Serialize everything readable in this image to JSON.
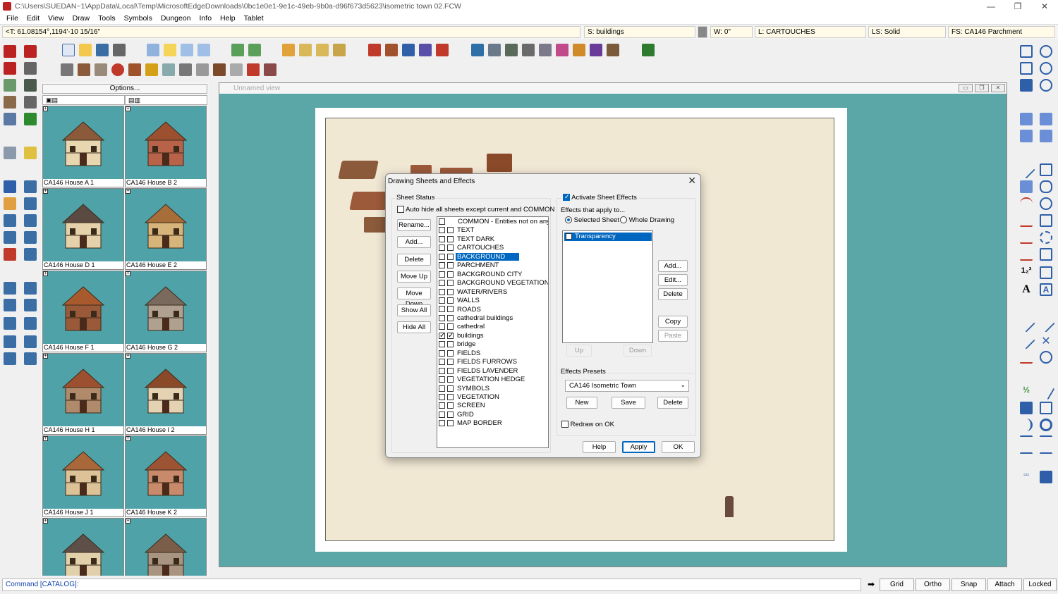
{
  "titlebar": {
    "title": "C:\\Users\\SUEDAN~1\\AppData\\Local\\Temp\\MicrosoftEdgeDownloads\\0bc1e0e1-9e1c-49eb-9b0a-d96f673d5623\\isometric town 02.FCW",
    "minimize": "—",
    "maximize": "❐",
    "close": "✕"
  },
  "menu": [
    "File",
    "Edit",
    "View",
    "Draw",
    "Tools",
    "Symbols",
    "Dungeon",
    "Info",
    "Help",
    "Tablet"
  ],
  "status": {
    "coords": "<T: 61.08154°,1194'-10 15/16\"",
    "sheet": "S: buildings",
    "width": "W: 0\"",
    "layer": "L: CARTOUCHES",
    "linestyle": "LS: Solid",
    "fillstyle": "FS: CA146 Parchment"
  },
  "catalog": {
    "options": "Options...",
    "items": [
      {
        "name": "CA146 House A 1",
        "roof": "#8a5a3a",
        "wall": "#e8d6b0"
      },
      {
        "name": "CA146 House B 2",
        "roof": "#9c5030",
        "wall": "#b8624a"
      },
      {
        "name": "CA146 House D 1",
        "roof": "#5a4a42",
        "wall": "#e6d2aa"
      },
      {
        "name": "CA146 House E 2",
        "roof": "#a86e3a",
        "wall": "#d6b47a"
      },
      {
        "name": "CA146 House F 1",
        "roof": "#a85a2e",
        "wall": "#9a5a3a"
      },
      {
        "name": "CA146 House G 2",
        "roof": "#7a6a5e",
        "wall": "#b0a090"
      },
      {
        "name": "CA146 House H 1",
        "roof": "#9c5030",
        "wall": "#b08a6a"
      },
      {
        "name": "CA146 House I 2",
        "roof": "#8a4a2a",
        "wall": "#e4d2b2"
      },
      {
        "name": "CA146 House J 1",
        "roof": "#a8683a",
        "wall": "#dcc296"
      },
      {
        "name": "CA146 House K 2",
        "roof": "#9c5434",
        "wall": "#c88a6a"
      },
      {
        "name": "",
        "roof": "#5e5048",
        "wall": "#e2d0aa"
      },
      {
        "name": "",
        "roof": "#7a5e4a",
        "wall": "#a89480"
      }
    ]
  },
  "viewport": {
    "title": "Unnamed view"
  },
  "command": {
    "text": "Command [CATALOG]:"
  },
  "statusbuttons": [
    "Grid",
    "Ortho",
    "Snap",
    "Attach",
    "Locked"
  ],
  "dialog": {
    "title": "Drawing Sheets and Effects",
    "close": "✕",
    "sheet_status": "Sheet Status",
    "auto_hide": "Auto hide all sheets except current and COMMON",
    "buttons": [
      "Rename...",
      "Add...",
      "Delete",
      "Move Up",
      "Move Down",
      "Show All",
      "Hide All"
    ],
    "sheets": [
      {
        "label": "COMMON - Entities not on any",
        "visible": false,
        "selected": false,
        "single": true
      },
      {
        "label": "TEXT",
        "visible": false,
        "selected": false
      },
      {
        "label": "TEXT DARK",
        "visible": false,
        "selected": false
      },
      {
        "label": "CARTOUCHES",
        "visible": false,
        "selected": false
      },
      {
        "label": "BACKGROUND",
        "visible": false,
        "selected": true
      },
      {
        "label": "PARCHMENT",
        "visible": false,
        "selected": false
      },
      {
        "label": "BACKGROUND CITY",
        "visible": false,
        "selected": false
      },
      {
        "label": "BACKGROUND VEGETATION",
        "visible": false,
        "selected": false
      },
      {
        "label": "WATER/RIVERS",
        "visible": false,
        "selected": false
      },
      {
        "label": "WALLS",
        "visible": false,
        "selected": false
      },
      {
        "label": "ROADS",
        "visible": false,
        "selected": false
      },
      {
        "label": "cathedral buildings",
        "visible": false,
        "selected": false
      },
      {
        "label": "cathedral",
        "visible": false,
        "selected": false
      },
      {
        "label": "buildings",
        "visible": true,
        "selected": false
      },
      {
        "label": "bridge",
        "visible": false,
        "selected": false
      },
      {
        "label": "FIELDS",
        "visible": false,
        "selected": false
      },
      {
        "label": "FIELDS FURROWS",
        "visible": false,
        "selected": false
      },
      {
        "label": "FIELDS LAVENDER",
        "visible": false,
        "selected": false
      },
      {
        "label": "VEGETATION HEDGE",
        "visible": false,
        "selected": false
      },
      {
        "label": "SYMBOLS",
        "visible": false,
        "selected": false
      },
      {
        "label": "VEGETATION",
        "visible": false,
        "selected": false
      },
      {
        "label": "SCREEN",
        "visible": false,
        "selected": false
      },
      {
        "label": "GRID",
        "visible": false,
        "selected": false
      },
      {
        "label": "MAP BORDER",
        "visible": false,
        "selected": false
      }
    ],
    "activate_effects": "Activate Sheet Effects",
    "effects_apply": "Effects that apply to...",
    "radio_selected": "Selected Sheet",
    "radio_whole": "Whole Drawing",
    "effects": [
      {
        "label": "Transparency",
        "selected": true
      }
    ],
    "effect_buttons": {
      "add": "Add...",
      "edit": "Edit...",
      "delete": "Delete",
      "copy": "Copy",
      "paste": "Paste",
      "up": "Up",
      "down": "Down"
    },
    "presets_label": "Effects Presets",
    "preset_value": "CA146 Isometric Town",
    "preset_buttons": {
      "new": "New",
      "save": "Save",
      "delete": "Delete"
    },
    "redraw": "Redraw on OK",
    "footer": {
      "help": "Help",
      "apply": "Apply",
      "ok": "OK"
    }
  }
}
